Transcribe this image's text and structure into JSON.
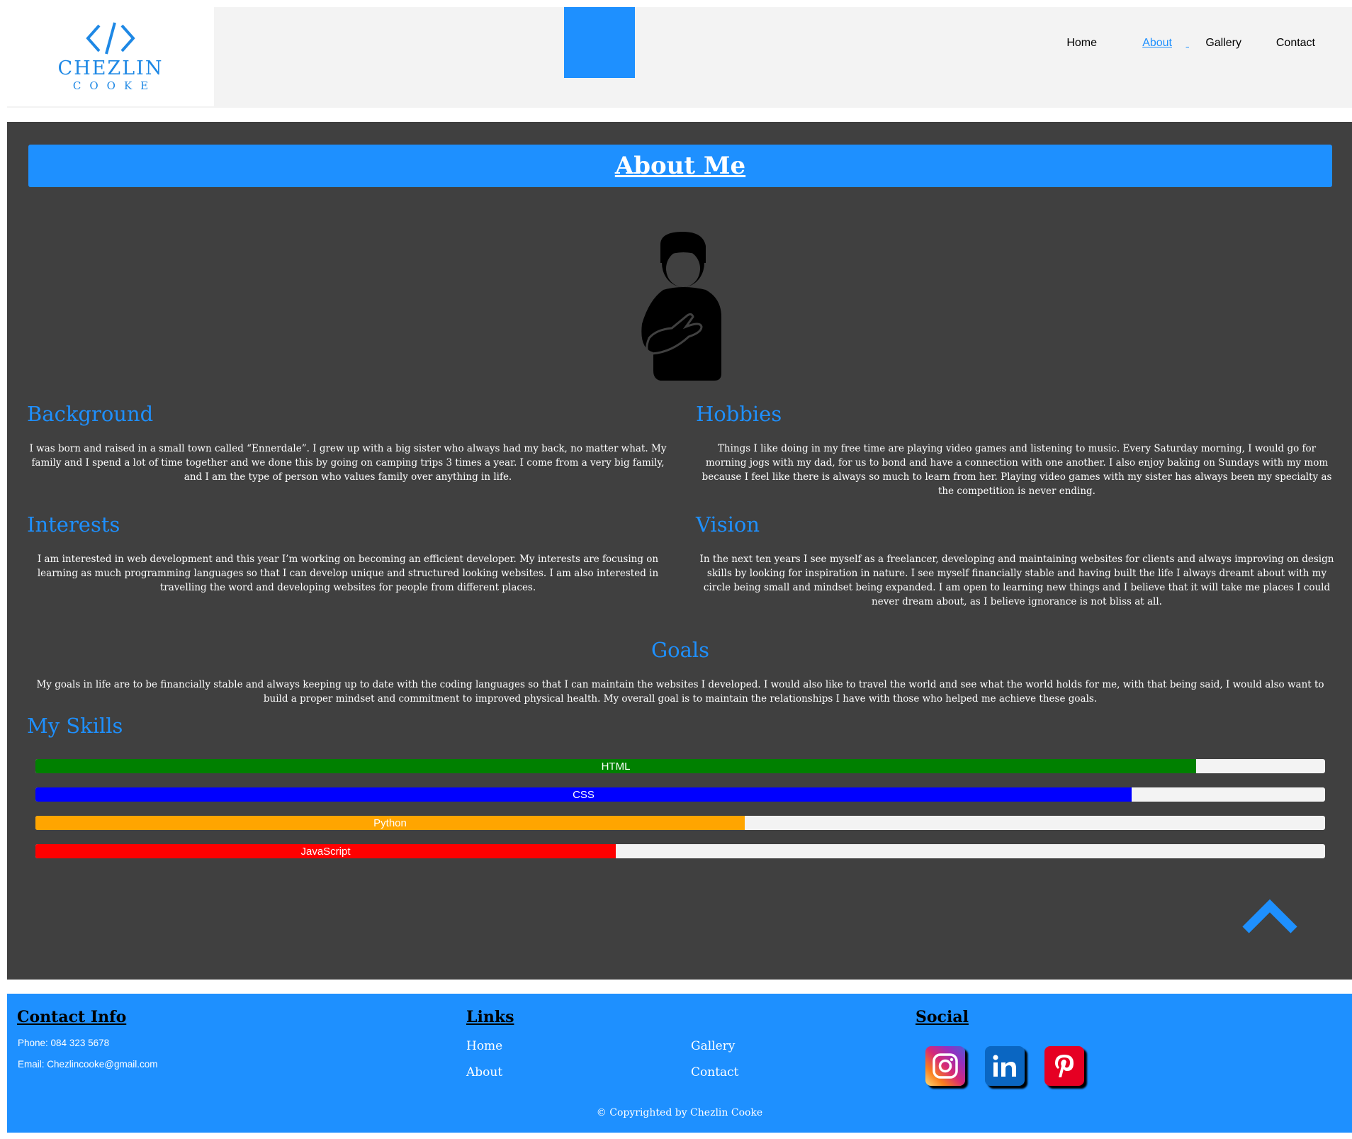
{
  "brand": {
    "name": "CHEZLIN",
    "sub": "COOKE"
  },
  "nav": {
    "home": "Home",
    "about": "About",
    "gallery": "Gallery",
    "contact": "Contact"
  },
  "page": {
    "title": "About Me"
  },
  "sections": {
    "background": {
      "title": "Background",
      "text": "I was born and raised in a small town called “Ennerdale”. I grew up with a big sister who always had my back, no matter what. My family and I spend a lot of time together and we done this by going on camping trips 3 times a year. I come from a very big family, and I am the type of person who values family over anything in life."
    },
    "hobbies": {
      "title": "Hobbies",
      "text": "Things I like doing in my free time are playing video games and listening to music. Every Saturday morning, I would go for morning jogs with my dad, for us to bond and have a connection with one another. I also enjoy baking on Sundays with my mom because I feel like there is always so much to learn from her. Playing video games with my sister has always been my specialty as the competition is never ending."
    },
    "interests": {
      "title": "Interests",
      "text": "I am interested in web development and this year I’m working on becoming an efficient developer. My interests are focusing on learning as much programming languages so that I can develop unique and structured looking websites. I am also interested in travelling the word and developing websites for people from different places."
    },
    "vision": {
      "title": "Vision",
      "text": "In the next ten years I see myself as a freelancer, developing and maintaining websites for clients and always improving on design skills by looking for inspiration in nature. I see myself financially stable and having built the life I always dreamt about with my circle being small and mindset being expanded. I am open to learning new things and I believe that it will take me places I could never dream about, as I believe ignorance is not bliss at all."
    },
    "goals": {
      "title": "Goals",
      "text": "My goals in life are to be financially stable and always keeping up to date with the coding languages so that I can maintain the websites I developed. I would also like to travel the world and see what the world holds for me, with that being said, I would also want to build a proper mindset and commitment to improved physical health. My overall goal is to maintain the relationships I have with those who helped me achieve these goals."
    }
  },
  "skills": {
    "title": "My Skills",
    "items": [
      {
        "label": "HTML",
        "level": 0.9,
        "color": "#008000"
      },
      {
        "label": "CSS",
        "level": 0.85,
        "color": "#0000ff"
      },
      {
        "label": "Python",
        "level": 0.55,
        "color": "#ffa500"
      },
      {
        "label": "JavaScript",
        "level": 0.45,
        "color": "#ff0000"
      }
    ]
  },
  "footer": {
    "contact_title": "Contact Info",
    "phone": "Phone: 084 323 5678",
    "email": "Email: Chezlincooke@gmail.com",
    "links_title": "Links",
    "links": {
      "home": "Home",
      "about": "About",
      "gallery": "Gallery",
      "contact": "Contact"
    },
    "social_title": "Social",
    "social_icons": [
      "instagram-icon",
      "linkedin-icon",
      "pinterest-icon"
    ],
    "copyright": "© Copyrighted by Chezlin Cooke"
  },
  "colors": {
    "accent": "#1e90ff",
    "panel": "#404040",
    "header": "#f3f3f3"
  }
}
